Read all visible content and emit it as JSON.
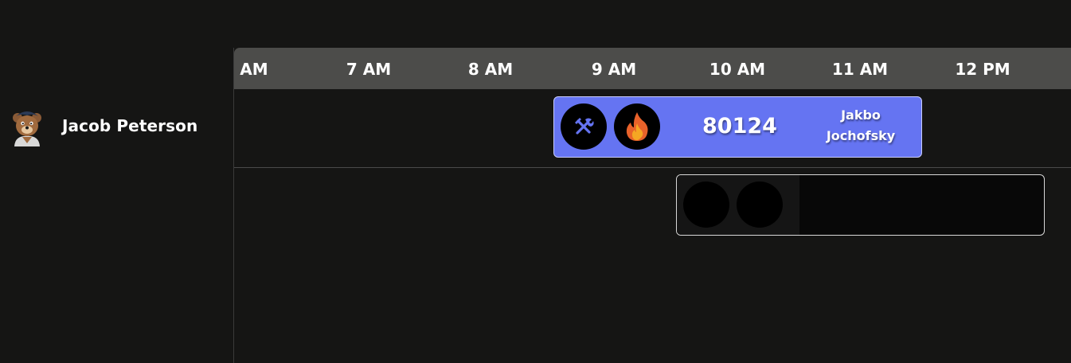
{
  "resource": {
    "name": "Jacob Peterson",
    "avatar_icon": "bear-mascot-icon"
  },
  "timeline": {
    "hours": [
      "AM",
      "7 AM",
      "8 AM",
      "9 AM",
      "10 AM",
      "11 AM",
      "12 PM"
    ]
  },
  "events": [
    {
      "number": "80124",
      "person": "Jakbo Jochofsky",
      "type_icon": "tools-icon",
      "priority_icon": "fire-icon",
      "color": "#6574f2"
    }
  ],
  "colors": {
    "background": "#151514",
    "header": "#4c4c4a",
    "accent": "#6574f2"
  }
}
